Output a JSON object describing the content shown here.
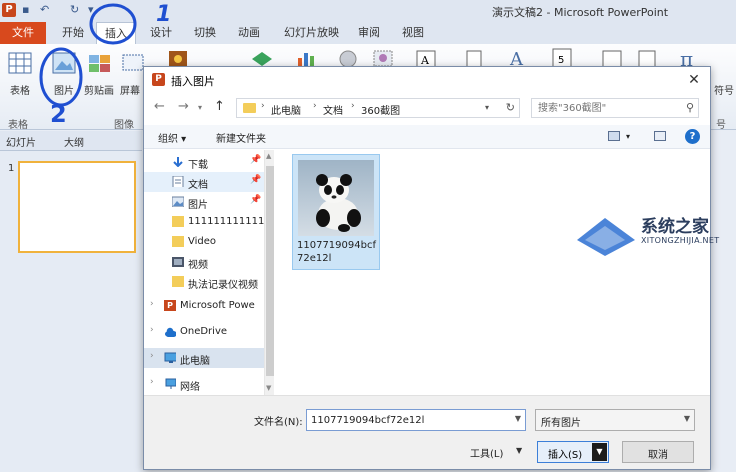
{
  "app": {
    "logo": "P",
    "window_title": "演示文稿2 - Microsoft PowerPoint",
    "file_tab": "文件",
    "tabs": [
      "开始",
      "插入",
      "设计",
      "切换",
      "动画",
      "幻灯片放映",
      "审阅",
      "视图"
    ],
    "active_tab": "插入"
  },
  "ribbon": {
    "buttons": {
      "table": "表格",
      "picture": "图片",
      "clipart": "剪贴画",
      "screenshot": "屏幕",
      "symbol": "符号"
    },
    "groups": {
      "table": "表格",
      "image": "图像",
      "symbol": "号"
    }
  },
  "annotations": {
    "mark_1": "1",
    "mark_2": "2"
  },
  "left_pane": {
    "tabs": [
      "幻灯片",
      "大纲"
    ],
    "slide_number": "1"
  },
  "dialog": {
    "title": "插入图片",
    "close_glyph": "✕",
    "breadcrumb": [
      "此电脑",
      "文档",
      "360截图"
    ],
    "search_placeholder": "搜索\"360截图\"",
    "toolbar": {
      "organize": "组织 ▾",
      "new_folder": "新建文件夹",
      "help": "?"
    },
    "nav_items": [
      {
        "label": "下载",
        "pinned": true
      },
      {
        "label": "文档",
        "pinned": true,
        "selected": true
      },
      {
        "label": "图片",
        "pinned": true
      },
      {
        "label": "111111111111"
      },
      {
        "label": "Video"
      },
      {
        "label": "视频"
      },
      {
        "label": "执法记录仪视频"
      },
      {
        "label": "Microsoft Powe"
      },
      {
        "label": "OneDrive"
      },
      {
        "label": "此电脑",
        "selected": true
      },
      {
        "label": "网络"
      }
    ],
    "file": {
      "name": "1107719094bcf72e12l"
    },
    "filename_label": "文件名(N):",
    "filename_value": "1107719094bcf72e12l",
    "filter": "所有图片",
    "tools": "工具(L)",
    "insert": "插入(S)",
    "cancel": "取消"
  },
  "watermark": {
    "text": "系统之家",
    "sub": "XITONGZHIJIA.NET"
  },
  "colors": {
    "accent": "#2b5fb6",
    "file_tab": "#d8491d",
    "selection": "#cce4f7",
    "annotation": "#1f4fd1"
  }
}
